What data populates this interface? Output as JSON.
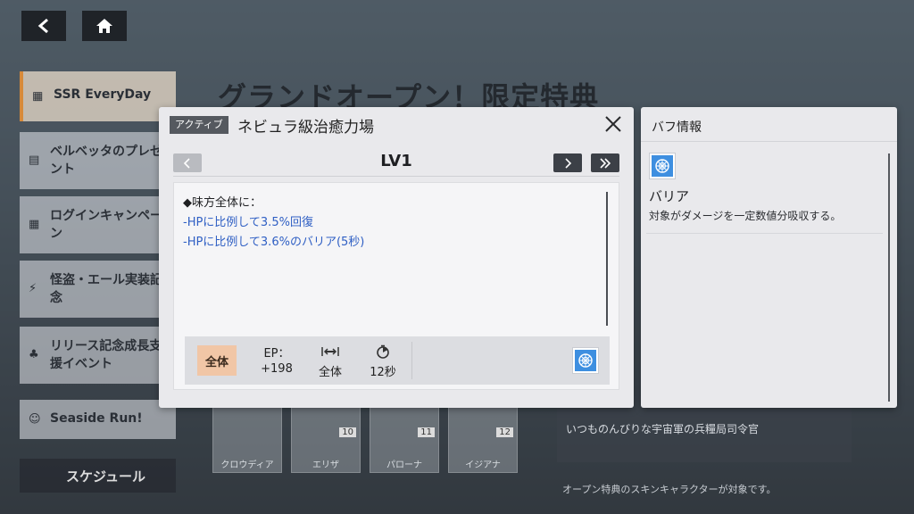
{
  "background": {
    "title": "グランドオープン！限定特典",
    "sidebar": [
      {
        "label": "SSR EveryDay",
        "icon": "calendar-icon"
      },
      {
        "label": "ベルベッタのプレゼント",
        "icon": "gift-icon"
      },
      {
        "label": "ログインキャンペーン",
        "icon": "calendar-icon"
      },
      {
        "label": "怪盗・エール実装記念",
        "icon": "bolt-icon"
      },
      {
        "label": "リリース記念成長支援イベント",
        "icon": "users-icon"
      },
      {
        "label": "Seaside Run!",
        "icon": "person-icon"
      }
    ],
    "schedule_label": "スケジュール",
    "characters": [
      {
        "name": "クロウディア",
        "no": ""
      },
      {
        "name": "エリザ",
        "no": "10"
      },
      {
        "name": "パローナ",
        "no": "11"
      },
      {
        "name": "イジアナ",
        "no": "12"
      }
    ],
    "card_text": "いつものんびりな宇宙軍の兵糧局司令官",
    "footnote": "オープン特典のスキンキャラクターが対象です。"
  },
  "dialog": {
    "tag": "アクティブ",
    "skill_name": "ネビュラ級治癒力場",
    "level": "LV1",
    "description": {
      "head": "◆味方全体に：",
      "lines": [
        "-HPに比例して3.5%回復",
        "-HPに比例して3.6%のバリア(5秒)"
      ]
    },
    "stats": {
      "target": "全体",
      "ep_label": "EP：",
      "ep_value": "+198",
      "range_value": "全体",
      "cooldown_value": "12秒"
    }
  },
  "buff_panel": {
    "title": "バフ情報",
    "buff_name": "バリア",
    "buff_desc": "対象がダメージを一定数値分吸収する。"
  },
  "colors": {
    "link_blue": "#2f5fc4",
    "target_tag": "#f1c6a6",
    "buff_icon_bg": "#3e8fe0"
  }
}
